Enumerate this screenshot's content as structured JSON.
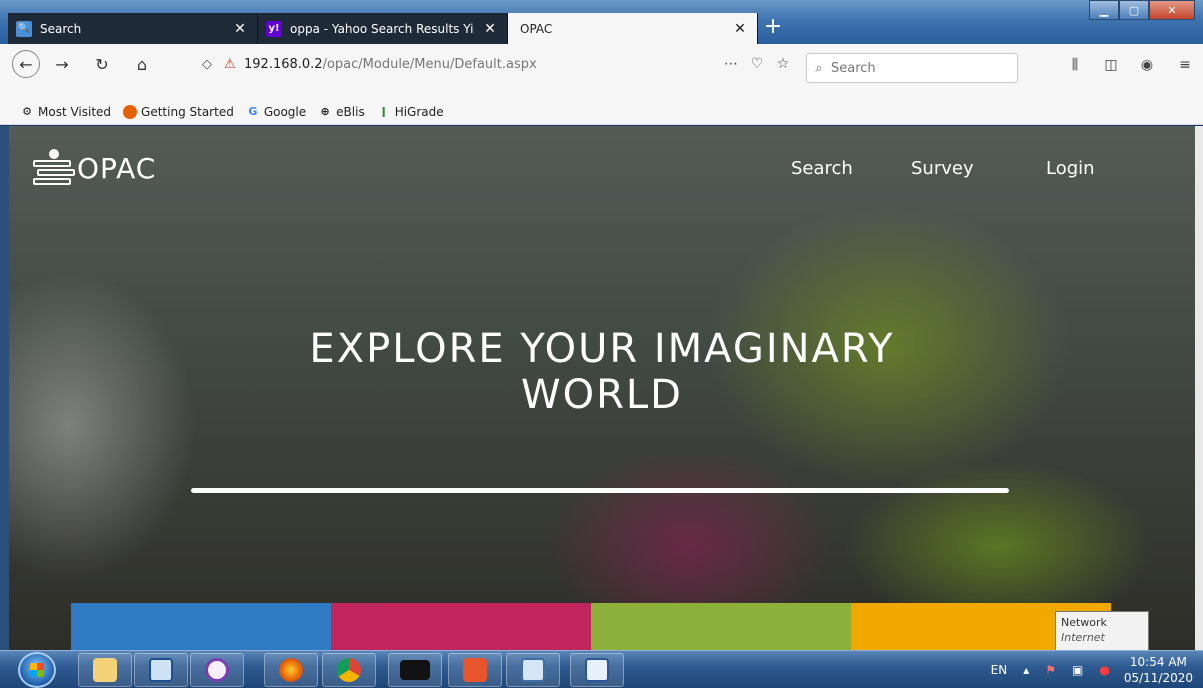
{
  "browser": {
    "tabs": [
      {
        "title": "Search",
        "favicon": "search-tab-icon",
        "active": false
      },
      {
        "title": "oppa - Yahoo Search Results Yi",
        "favicon": "yahoo-icon",
        "active": false
      },
      {
        "title": "OPAC",
        "favicon": "",
        "active": true
      }
    ],
    "close_glyph": "✕",
    "new_tab_glyph": "+",
    "url_host": "192.168.0.2",
    "url_path": "/opac/Module/Menu/Default.aspx",
    "search_placeholder": "Search",
    "bookmarks": [
      {
        "label": "Most Visited",
        "icon": "gear-icon"
      },
      {
        "label": "Getting Started",
        "icon": "firefox-icon"
      },
      {
        "label": "Google",
        "icon": "google-icon"
      },
      {
        "label": "eBlis",
        "icon": "globe-icon"
      },
      {
        "label": "HiGrade",
        "icon": "higrade-icon"
      }
    ]
  },
  "page": {
    "logo_text": "OPAC",
    "nav": [
      "Search",
      "Survey",
      "Login"
    ],
    "hero_line1": "EXPLORE YOUR IMAGINARY",
    "hero_line2": "WORLD",
    "band_colors": [
      "#2f7ac2",
      "#c0265d",
      "#8db03b",
      "#f1a900"
    ]
  },
  "tooltip": {
    "title": "Network",
    "subtitle": "Internet access"
  },
  "taskbar": {
    "language": "EN",
    "time": "10:54 AM",
    "date": "05/11/2020"
  }
}
